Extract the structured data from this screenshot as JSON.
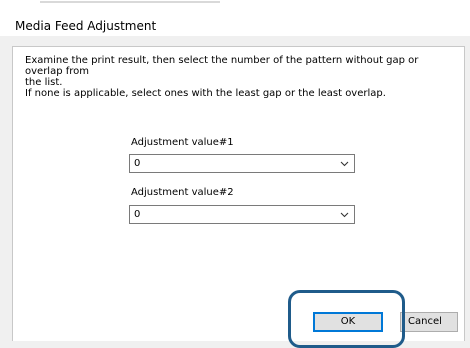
{
  "window": {
    "title": "Media Feed Adjustment"
  },
  "instructions": {
    "line1": "Examine the print result, then select the number of the pattern without gap or overlap from",
    "line2": "the list.",
    "line3": "If none is applicable, select ones with the least gap or the least overlap."
  },
  "adjustments": [
    {
      "label": "Adjustment value#1",
      "value": "0"
    },
    {
      "label": "Adjustment value#2",
      "value": "0"
    }
  ],
  "buttons": {
    "ok": "OK",
    "cancel": "Cancel"
  },
  "icons": {
    "dropdown": "chevron-down-icon"
  },
  "colors": {
    "focus_ring": "#1f5b8a",
    "default_button_border": "#0078d7"
  }
}
